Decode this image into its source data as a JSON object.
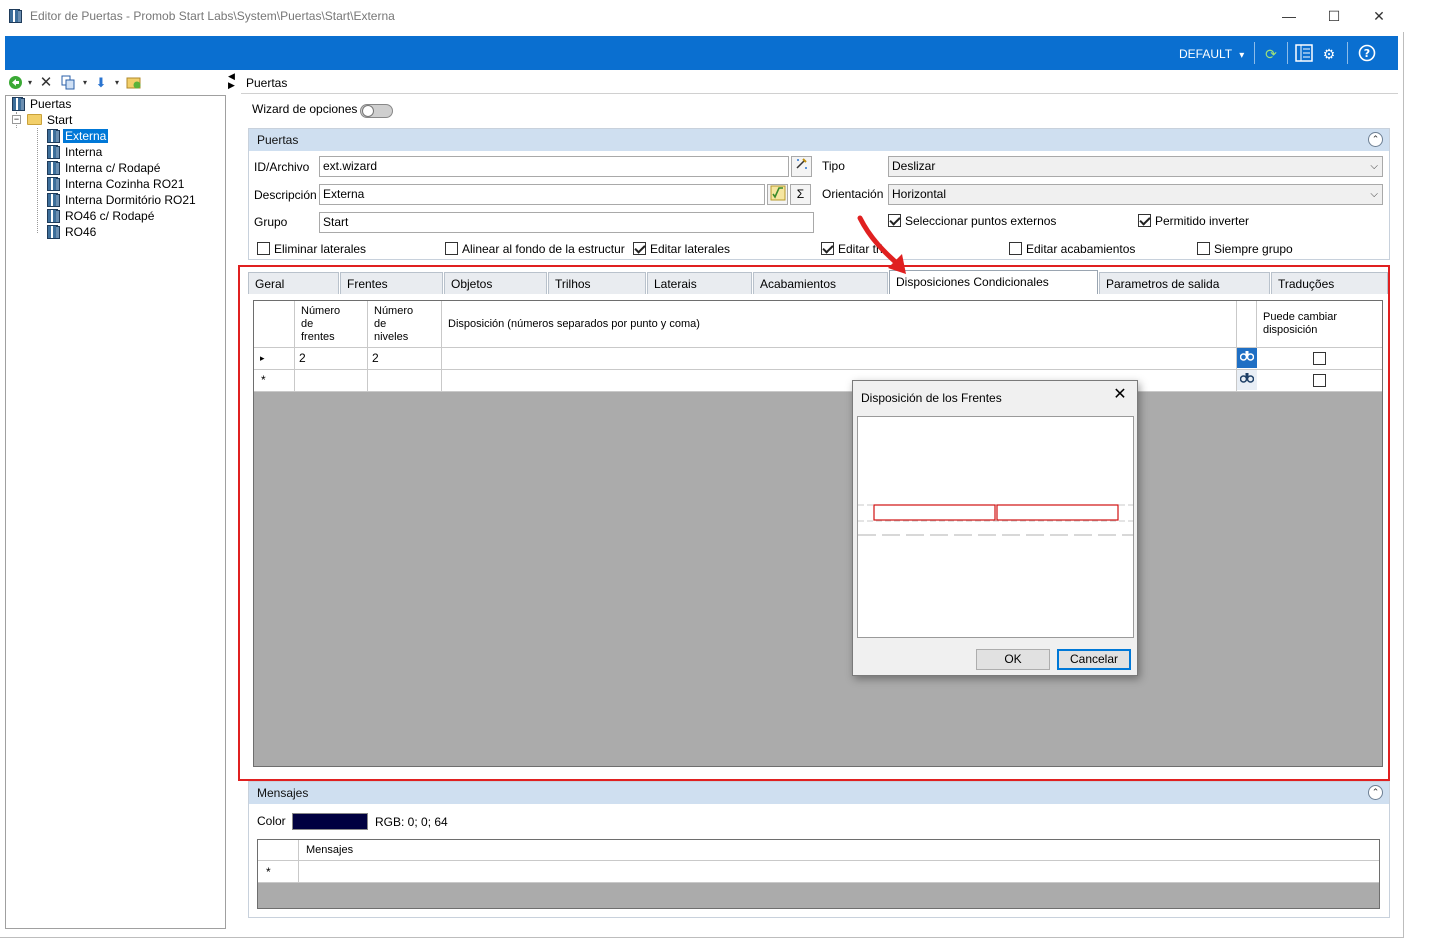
{
  "window": {
    "title": "Editor de Puertas - Promob Start Labs\\System\\Puertas\\Start\\Externa",
    "minimize": "—",
    "maximize": "☐",
    "close": "✕"
  },
  "topbar": {
    "profile": "DEFAULT",
    "profile_arrow": "▾"
  },
  "tree": {
    "root": "Puertas",
    "folder": "Start",
    "items": [
      "Externa",
      "Interna",
      "Interna c/ Rodapé",
      "Interna Cozinha RO21",
      "Interna Dormitório RO21",
      "RO46 c/ Rodapé",
      "RO46"
    ]
  },
  "right": {
    "breadcrumb": "Puertas",
    "wizard_label": "Wizard de opciones"
  },
  "doors_group": {
    "title": "Puertas",
    "id_label": "ID/Archivo",
    "id_value": "ext.wizard",
    "desc_label": "Descripción",
    "desc_value": "Externa",
    "group_label": "Grupo",
    "group_value": "Start",
    "tipo_label": "Tipo",
    "tipo_value": "Deslizar",
    "orient_label": "Orientación",
    "orient_value": "Horizontal",
    "sigma": "Σ",
    "checkboxes": {
      "sel_puntos": "Seleccionar puntos externos",
      "permitido": "Permitido inverter",
      "eliminar": "Eliminar laterales",
      "alinear": "Alinear al fondo de la estructur",
      "editar_laterales": "Editar laterales",
      "editar_tri": "Editar tri",
      "editar_acab": "Editar acabamientos",
      "siempre": "Siempre grupo"
    }
  },
  "tabs": [
    "Geral",
    "Frentes",
    "Objetos",
    "Trilhos",
    "Laterais",
    "Acabamientos",
    "Disposiciones Condicionales",
    "Parametros de salida",
    "Traduções"
  ],
  "grid": {
    "headers": {
      "num_frentes": "Número\nde\nfrentes",
      "num_niveles": "Número\nde\nniveles",
      "disposicion": "Disposición (números separados por punto y coma)",
      "puede": "Puede cambiar\ndisposición"
    },
    "rows": [
      {
        "marker": "▸",
        "frentes": "2",
        "niveles": "2",
        "disposicion": "",
        "puede": false
      },
      {
        "marker": "*",
        "frentes": "",
        "niveles": "",
        "disposicion": "",
        "puede": false
      }
    ]
  },
  "dialog": {
    "title": "Disposición de los Frentes",
    "close": "✕",
    "ok": "OK",
    "cancel": "Cancelar"
  },
  "messages": {
    "title": "Mensajes",
    "color_label": "Color",
    "color_value": "RGB: 0; 0; 64",
    "color_hex": "#000040",
    "col_header": "Mensajes",
    "new_row_marker": "*"
  },
  "colors": {
    "accent_bar": "#0a6fd0",
    "selection": "#0078d7",
    "annotation_red": "#e02020"
  }
}
